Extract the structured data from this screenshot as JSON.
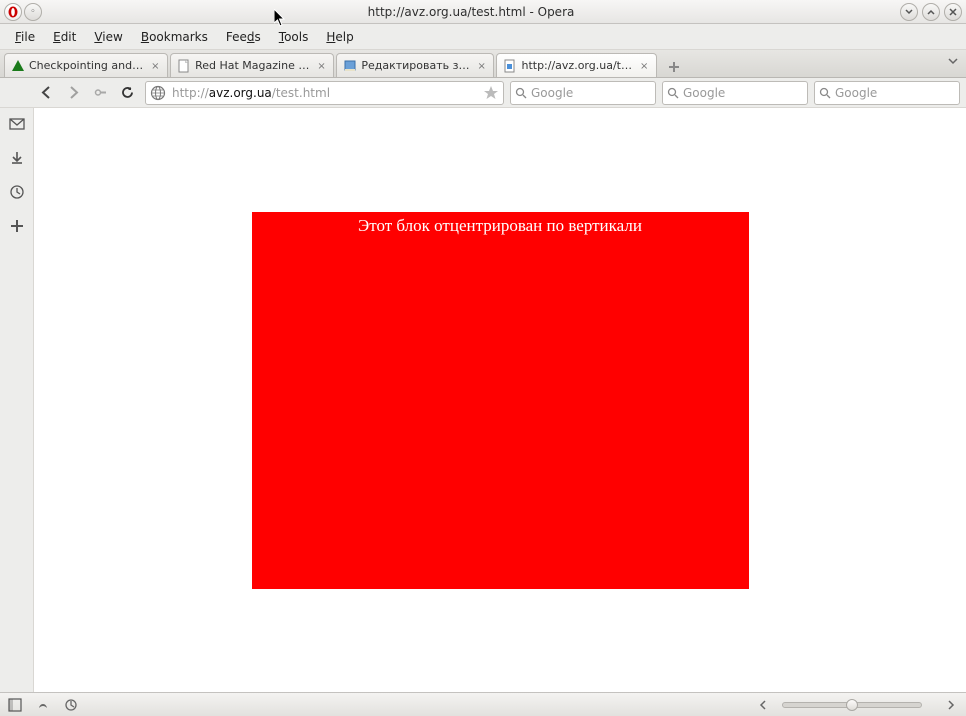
{
  "titlebar": {
    "title": "http://avz.org.ua/test.html - Opera"
  },
  "menu": {
    "file": "File",
    "edit": "Edit",
    "view": "View",
    "bookmarks": "Bookmarks",
    "feeds": "Feeds",
    "tools": "Tools",
    "help": "Help"
  },
  "tabs": [
    {
      "label": "Checkpointing and…",
      "icon": "green-pyramid"
    },
    {
      "label": "Red Hat Magazine …",
      "icon": "page"
    },
    {
      "label": "Редактировать з…",
      "icon": "book"
    },
    {
      "label": "http://avz.org.ua/t…",
      "icon": "page-blue"
    }
  ],
  "toolbar": {
    "url_prefix": "http://",
    "url_domain": "avz.org.ua",
    "url_path": "/test.html"
  },
  "search": {
    "placeholder1": "Google",
    "placeholder2": "Google",
    "placeholder3": "Google"
  },
  "page": {
    "heading": "Этот блок отцентрирован по вертикали"
  },
  "colors": {
    "block_bg": "#ff0000",
    "block_fg": "#ffffff"
  }
}
